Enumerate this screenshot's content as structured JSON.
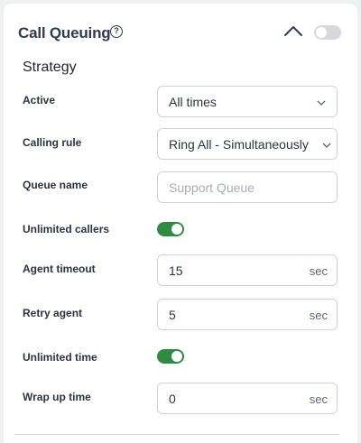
{
  "header": {
    "title": "Call Queuing",
    "help_icon_text": "?",
    "collapse_icon": "chevron-up-icon",
    "enabled": false
  },
  "strategy": {
    "title": "Strategy",
    "active": {
      "label": "Active",
      "value": "All times"
    },
    "calling_rule": {
      "label": "Calling rule",
      "value": "Ring All - Simultaneously"
    },
    "queue_name": {
      "label": "Queue name",
      "value": "",
      "placeholder": "Support Queue"
    },
    "unlimited_callers": {
      "label": "Unlimited callers",
      "enabled": true
    },
    "agent_timeout": {
      "label": "Agent timeout",
      "value": "15",
      "unit": "sec"
    },
    "retry_agent": {
      "label": "Retry agent",
      "value": "5",
      "unit": "sec"
    },
    "unlimited_time": {
      "label": "Unlimited time",
      "enabled": true
    },
    "wrap_up_time": {
      "label": "Wrap up time",
      "value": "0",
      "unit": "sec"
    }
  },
  "colors": {
    "toggle_on": "#2e8b3f",
    "toggle_off": "#d6d8dc",
    "title": "#2f3a52"
  }
}
